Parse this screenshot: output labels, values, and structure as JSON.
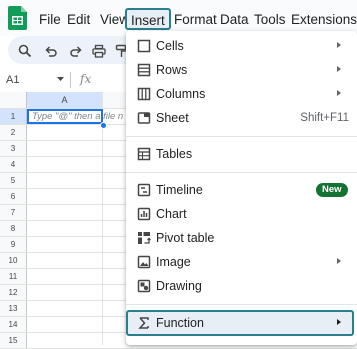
{
  "menubar": {
    "items": [
      {
        "label": "File"
      },
      {
        "label": "Edit"
      },
      {
        "label": "View"
      },
      {
        "label": "Insert"
      },
      {
        "label": "Format"
      },
      {
        "label": "Data"
      },
      {
        "label": "Tools"
      },
      {
        "label": "Extensions"
      }
    ],
    "active_item": "Insert"
  },
  "toolbar": {
    "icons": [
      "search-icon",
      "undo-icon",
      "redo-icon",
      "print-icon",
      "paint-format-icon"
    ]
  },
  "formula_bar": {
    "name_box": "A1",
    "fx_label": "fx"
  },
  "grid": {
    "column_headers": [
      "A"
    ],
    "row_numbers": [
      "1",
      "2",
      "3",
      "4",
      "5",
      "6",
      "7",
      "8",
      "9",
      "10",
      "11",
      "12",
      "13",
      "14",
      "15"
    ],
    "active_cell_placeholder": "Type \"@\" then a file n"
  },
  "insert_menu": {
    "items": [
      {
        "label": "Cells",
        "icon": "cells-icon",
        "submenu": true
      },
      {
        "label": "Rows",
        "icon": "rows-icon",
        "submenu": true
      },
      {
        "label": "Columns",
        "icon": "columns-icon",
        "submenu": true
      },
      {
        "label": "Sheet",
        "icon": "sheet-icon",
        "shortcut": "Shift+F11"
      },
      {
        "label": "Tables",
        "icon": "tables-icon"
      },
      {
        "label": "Timeline",
        "icon": "timeline-icon",
        "badge": "New"
      },
      {
        "label": "Chart",
        "icon": "chart-icon"
      },
      {
        "label": "Pivot table",
        "icon": "pivot-table-icon"
      },
      {
        "label": "Image",
        "icon": "image-icon",
        "submenu": true
      },
      {
        "label": "Drawing",
        "icon": "drawing-icon"
      },
      {
        "label": "Function",
        "icon": "function-icon",
        "submenu": true,
        "highlighted": true
      }
    ]
  },
  "colors": {
    "accent_highlight_border": "#2a7f8c",
    "selection_blue": "#1a73e8",
    "new_badge": "#137333",
    "sheets_logo_green": "#0f9d58"
  }
}
